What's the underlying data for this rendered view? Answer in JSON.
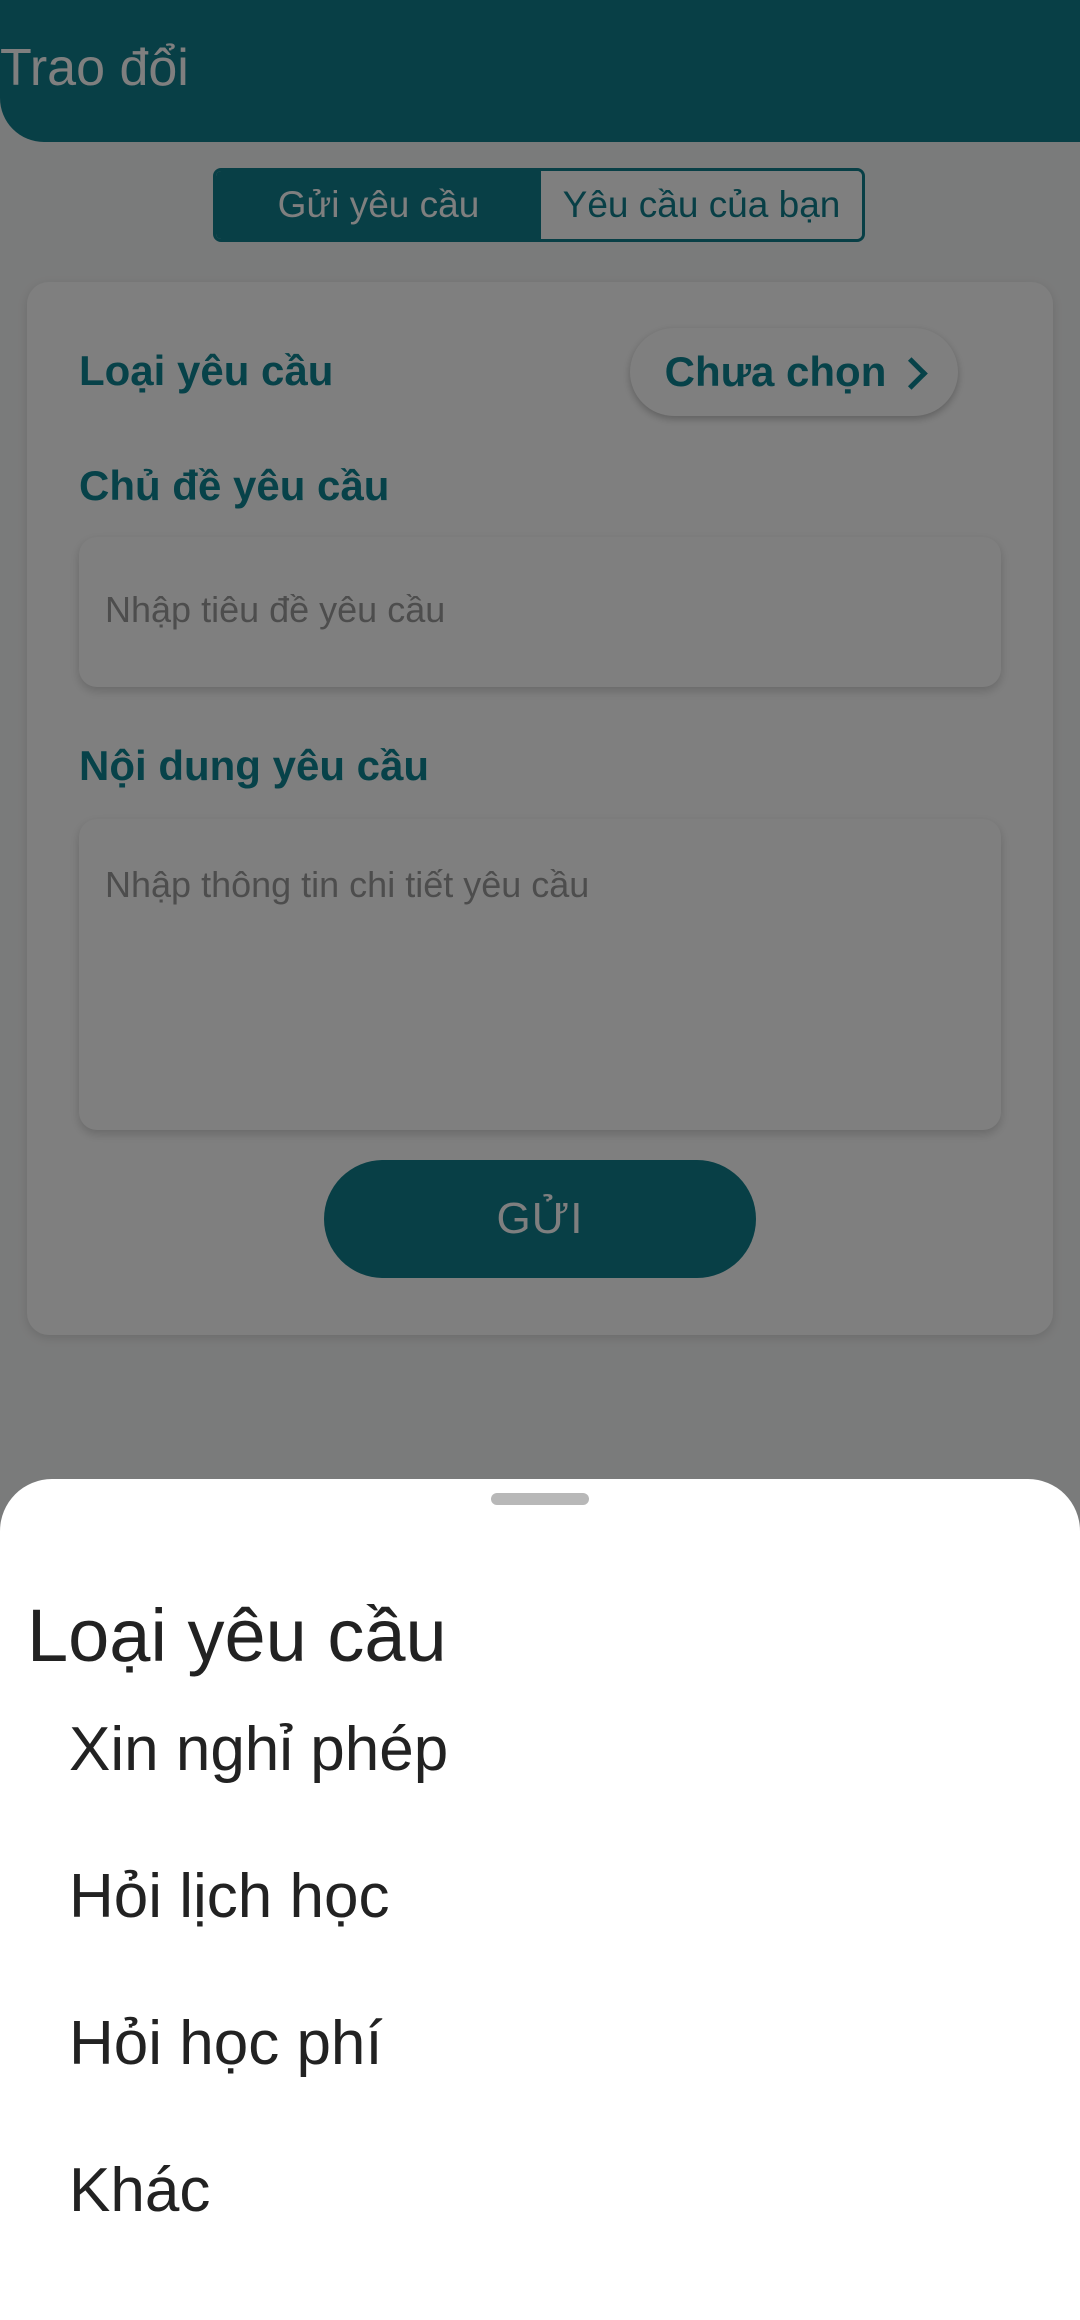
{
  "header": {
    "title": "Trao đổi"
  },
  "tabs": [
    {
      "label": "Gửi yêu cầu",
      "active": true
    },
    {
      "label": "Yêu cầu của bạn",
      "active": false
    }
  ],
  "form": {
    "type_label": "Loại yêu cầu",
    "type_value": "Chưa chọn",
    "subject_label": "Chủ đề yêu cầu",
    "subject_placeholder": "Nhập tiêu đề yêu cầu",
    "content_label": "Nội dung yêu cầu",
    "content_placeholder": "Nhập thông tin chi tiết yêu cầu",
    "submit_label": "GỬI"
  },
  "sheet": {
    "title": "Loại yêu cầu",
    "options": [
      "Xin nghỉ phép",
      "Hỏi lịch học",
      "Hỏi học phí",
      "Khác"
    ]
  },
  "colors": {
    "primary": "#107f8c",
    "label": "#0f8593",
    "overlay": "rgba(0,0,0,0.5)"
  }
}
